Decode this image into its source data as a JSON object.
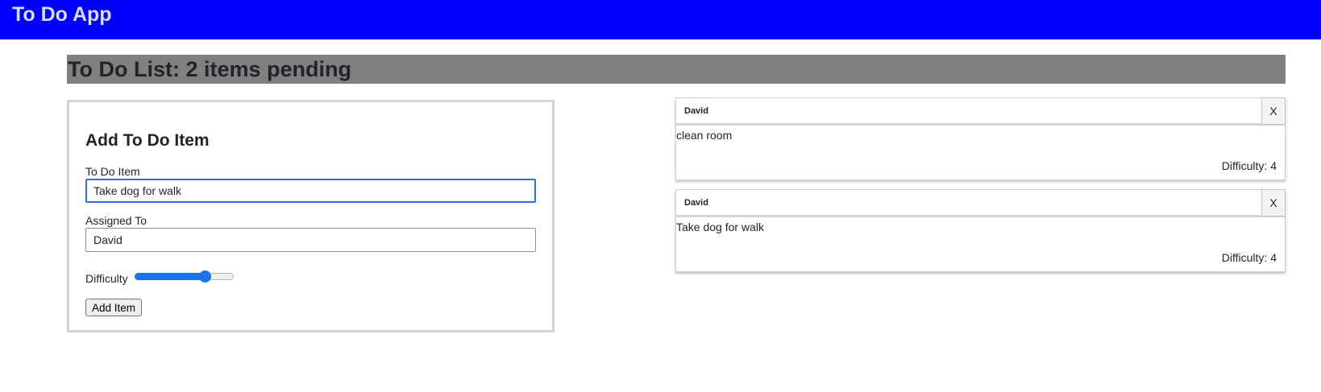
{
  "app": {
    "title": "To Do App",
    "header_color": "#0000ff"
  },
  "list": {
    "heading": "To Do List: 2 items pending"
  },
  "form": {
    "title": "Add To Do Item",
    "item_label": "To Do Item",
    "item_value": "Take dog for walk",
    "assignee_label": "Assigned To",
    "assignee_value": "David",
    "difficulty_label": "Difficulty",
    "difficulty_value": 4,
    "difficulty_min": 1,
    "difficulty_max": 5,
    "submit_label": "Add Item"
  },
  "todos": [
    {
      "assignee": "David",
      "text": "clean room",
      "difficulty": "Difficulty: 4",
      "delete_label": "X"
    },
    {
      "assignee": "David",
      "text": "Take dog for walk",
      "difficulty": "Difficulty: 4",
      "delete_label": "X"
    }
  ]
}
